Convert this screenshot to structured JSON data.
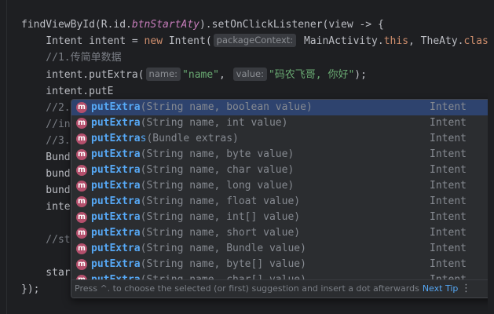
{
  "code": {
    "l1a": "findViewById(R.id.",
    "l1b": "btnStartAty",
    "l1c": ").setOnClickListener(view -> {",
    "l2a": "    Intent intent = ",
    "l2b": "new",
    "l2c": " Intent(",
    "l2hint": "packageContext:",
    "l2d": " MainActivity.",
    "l2e": "this",
    "l2f": ", TheAty.",
    "l2g": "class",
    "l3": "    //1.传简单数据",
    "l4a": "    intent.putExtra(",
    "l4hint1": "name:",
    "l4s1": "\"name\"",
    "l4b": ", ",
    "l4hint2": "value:",
    "l4s2": "\"码农飞哥, 你好\"",
    "l4c": ");",
    "l5": "    intent.putE",
    "l6": "    //2.",
    "l7": "    //in",
    "l8": "    //3.",
    "l9": "    Bund",
    "l10": "    bund",
    "l11": "    bund",
    "l12": "    inte",
    "l13": "    //st",
    "l14": "    star",
    "l15": "});"
  },
  "popup": {
    "items": [
      {
        "icon": "m",
        "bold": "putExtra",
        "sig": "(String name, boolean value)",
        "type": "Intent",
        "selected": true
      },
      {
        "icon": "m",
        "bold": "putExtra",
        "sig": "(String name, int value)",
        "type": "Intent"
      },
      {
        "icon": "m",
        "bold": "putExtra",
        "rest": "s",
        "sig": "(Bundle extras)",
        "type": "Intent"
      },
      {
        "icon": "m",
        "bold": "putExtra",
        "sig": "(String name, byte value)",
        "type": "Intent"
      },
      {
        "icon": "m",
        "bold": "putExtra",
        "sig": "(String name, char value)",
        "type": "Intent"
      },
      {
        "icon": "m",
        "bold": "putExtra",
        "sig": "(String name, long value)",
        "type": "Intent"
      },
      {
        "icon": "m",
        "bold": "putExtra",
        "sig": "(String name, float value)",
        "type": "Intent"
      },
      {
        "icon": "m",
        "bold": "putExtra",
        "sig": "(String name, int[] value)",
        "type": "Intent"
      },
      {
        "icon": "m",
        "bold": "putExtra",
        "sig": "(String name, short value)",
        "type": "Intent"
      },
      {
        "icon": "m",
        "bold": "putExtra",
        "sig": "(String name, Bundle value)",
        "type": "Intent"
      },
      {
        "icon": "m",
        "bold": "putExtra",
        "sig": "(String name, byte[] value)",
        "type": "Intent"
      },
      {
        "icon": "m",
        "bold": "putExtra",
        "sig": "(String name, char[] value)",
        "type": "Intent"
      }
    ],
    "footer_text": "Press ^. to choose the selected (or first) suggestion and insert a dot afterwards",
    "next_tip": "Next Tip",
    "more_icon": "⋮"
  },
  "colors": {
    "background": "#1e1f22",
    "popup_background": "#2b2d30",
    "selection": "#2e436e",
    "method_name": "#56a8f5",
    "method_icon": "#b44f6c",
    "keyword": "#cf8e6d",
    "string": "#6aab73",
    "comment": "#7a7e85"
  }
}
